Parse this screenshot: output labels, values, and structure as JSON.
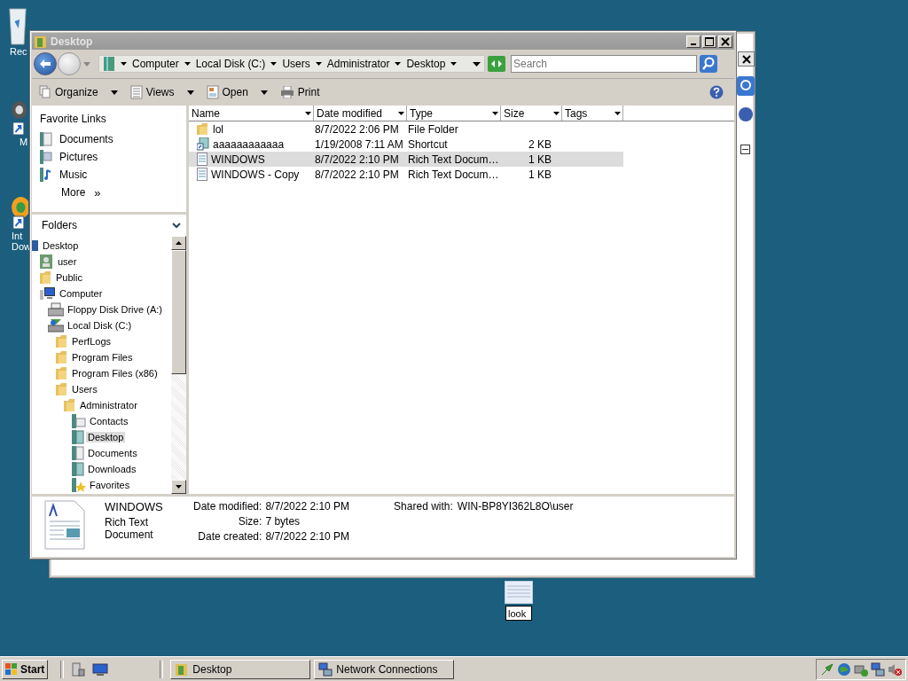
{
  "desktop_icons": [
    {
      "kind": "recycle",
      "lines": [
        "Rec"
      ]
    },
    {
      "kind": "shortcut",
      "lines": [
        "M"
      ]
    },
    {
      "kind": "browser",
      "lines": [
        "Int",
        "Dow"
      ]
    }
  ],
  "window": {
    "title": "Desktop"
  },
  "breadcrumb": [
    "Computer",
    "Local Disk (C:)",
    "Users",
    "Administrator",
    "Desktop"
  ],
  "search": {
    "placeholder": "Search"
  },
  "toolbar": [
    {
      "kind": "organize",
      "label": "Organize",
      "dropdown": true
    },
    {
      "kind": "views",
      "label": "Views",
      "dropdown": true
    },
    {
      "kind": "open",
      "label": "Open",
      "dropdown": true
    },
    {
      "kind": "print",
      "label": "Print",
      "dropdown": false
    }
  ],
  "favorite_links": {
    "title": "Favorite Links",
    "items": [
      {
        "kind": "documents",
        "label": "Documents"
      },
      {
        "kind": "pictures",
        "label": "Pictures"
      },
      {
        "kind": "music",
        "label": "Music"
      }
    ],
    "more": "More",
    "more_icon": "»"
  },
  "folders": {
    "title": "Folders",
    "tree": [
      {
        "kind": "desktop",
        "label": "Desktop",
        "selected": false,
        "children": [
          {
            "kind": "user",
            "label": "user",
            "selected": false
          },
          {
            "kind": "folder",
            "label": "Public",
            "selected": false
          },
          {
            "kind": "computer",
            "label": "Computer",
            "selected": false,
            "children": [
              {
                "kind": "floppy",
                "label": "Floppy Disk Drive (A:)",
                "selected": false
              },
              {
                "kind": "disk",
                "label": "Local Disk (C:)",
                "selected": false,
                "children": [
                  {
                    "kind": "folder",
                    "label": "PerfLogs",
                    "selected": false
                  },
                  {
                    "kind": "folder",
                    "label": "Program Files",
                    "selected": false
                  },
                  {
                    "kind": "folder",
                    "label": "Program Files (x86)",
                    "selected": false
                  },
                  {
                    "kind": "folder",
                    "label": "Users",
                    "selected": false,
                    "children": [
                      {
                        "kind": "folder",
                        "label": "Administrator",
                        "selected": false,
                        "children": [
                          {
                            "kind": "contacts",
                            "label": "Contacts",
                            "selected": false
                          },
                          {
                            "kind": "special",
                            "label": "Desktop",
                            "selected": true
                          },
                          {
                            "kind": "documents",
                            "label": "Documents",
                            "selected": false
                          },
                          {
                            "kind": "special",
                            "label": "Downloads",
                            "selected": false
                          },
                          {
                            "kind": "favorites",
                            "label": "Favorites",
                            "selected": false
                          }
                        ]
                      }
                    ]
                  }
                ]
              }
            ]
          }
        ]
      }
    ]
  },
  "columns": [
    "Name",
    "Date modified",
    "Type",
    "Size",
    "Tags"
  ],
  "rows": [
    {
      "kind": "folder",
      "name": "lol",
      "date": "8/7/2022 2:06 PM",
      "type": "File Folder",
      "size": "",
      "selected": false
    },
    {
      "kind": "shortcut",
      "name": "aaaaaaaaaaaa",
      "date": "1/19/2008 7:11 AM",
      "type": "Shortcut",
      "size": "2 KB",
      "selected": false
    },
    {
      "kind": "rtf",
      "name": "WINDOWS",
      "date": "8/7/2022 2:10 PM",
      "type": "Rich Text Docum…",
      "size": "1 KB",
      "selected": true
    },
    {
      "kind": "rtf",
      "name": "WINDOWS - Copy",
      "date": "8/7/2022 2:10 PM",
      "type": "Rich Text Docum…",
      "size": "1 KB",
      "selected": false
    }
  ],
  "details": {
    "name": "WINDOWS",
    "type": "Rich Text Document",
    "fields": [
      {
        "label": "Date modified:",
        "value": "8/7/2022 2:10 PM"
      },
      {
        "label": "Size:",
        "value": "7 bytes"
      },
      {
        "label": "Date created:",
        "value": "8/7/2022 2:10 PM"
      }
    ],
    "shared": {
      "label": "Shared with:",
      "value": "WIN-BP8YI362L8O\\user"
    }
  },
  "desktop_file": {
    "rename_value": "look"
  },
  "taskbar": {
    "start": "Start",
    "buttons": [
      "Desktop",
      "Network Connections"
    ]
  }
}
